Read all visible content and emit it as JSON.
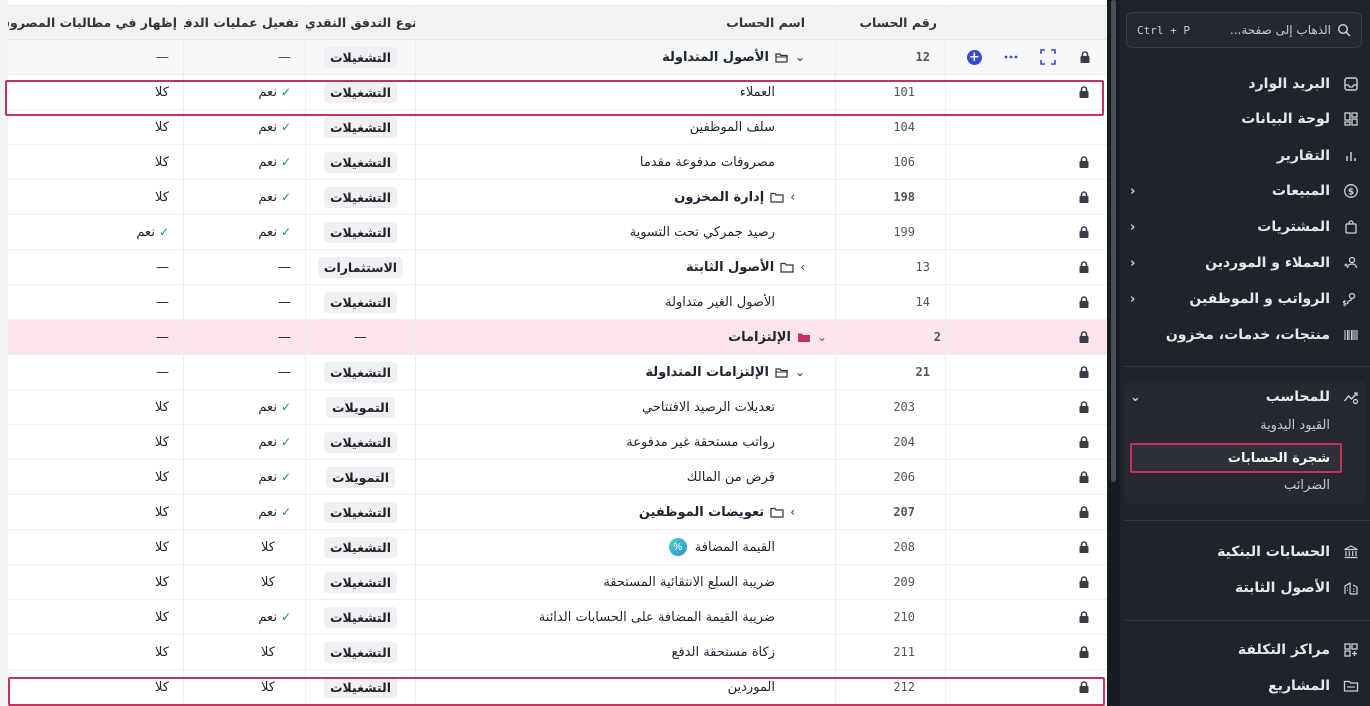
{
  "table": {
    "headers": {
      "num": "رقم الحساب",
      "name": "اسم الحساب",
      "flow": "نوع التدفق النقدي",
      "pay": "تفعيل عمليات الدفع",
      "exp": "إظهار في مطالبات المصروفات"
    },
    "rows": [
      {
        "num": "12",
        "name": "الأصول المتداولة",
        "flow": "التشغيلات",
        "pay": "—",
        "exp": "—"
      },
      {
        "num": "101",
        "name": "العملاء",
        "flow": "التشغيلات",
        "pay": "نعم",
        "exp": "كلا"
      },
      {
        "num": "104",
        "name": "سلف الموظفين",
        "flow": "التشغيلات",
        "pay": "نعم",
        "exp": "كلا"
      },
      {
        "num": "106",
        "name": "مصروفات مدفوعة مقدما",
        "flow": "التشغيلات",
        "pay": "نعم",
        "exp": "كلا"
      },
      {
        "num": "198",
        "name": "إدارة المخزون",
        "flow": "التشغيلات",
        "pay": "نعم",
        "exp": "كلا"
      },
      {
        "num": "199",
        "name": "رصيد جمركي تحت التسوية",
        "flow": "التشغيلات",
        "pay": "نعم",
        "exp": "نعم"
      },
      {
        "num": "13",
        "name": "الأصول الثابتة",
        "flow": "الاستثمارات",
        "pay": "—",
        "exp": "—"
      },
      {
        "num": "14",
        "name": "الأصول الغير متداولة",
        "flow": "التشغيلات",
        "pay": "—",
        "exp": "—"
      },
      {
        "num": "2",
        "name": "الإلتزامات",
        "flow": "—",
        "pay": "—",
        "exp": "—"
      },
      {
        "num": "21",
        "name": "الإلتزامات المتداولة",
        "flow": "التشغيلات",
        "pay": "—",
        "exp": "—"
      },
      {
        "num": "203",
        "name": "تعديلات الرصيد الافتتاحي",
        "flow": "التمويلات",
        "pay": "نعم",
        "exp": "كلا"
      },
      {
        "num": "204",
        "name": "رواتب مستحقة غير مدفوعة",
        "flow": "التشغيلات",
        "pay": "نعم",
        "exp": "كلا"
      },
      {
        "num": "206",
        "name": "قرض من المالك",
        "flow": "التمويلات",
        "pay": "نعم",
        "exp": "كلا"
      },
      {
        "num": "207",
        "name": "تعويضات الموظفين",
        "flow": "التشغيلات",
        "pay": "نعم",
        "exp": "كلا"
      },
      {
        "num": "208",
        "name": "القيمة المضافة",
        "flow": "التشغيلات",
        "pay": "كلا",
        "exp": "كلا"
      },
      {
        "num": "209",
        "name": "ضريبة السلع الانتقائية المستحقة",
        "flow": "التشغيلات",
        "pay": "كلا",
        "exp": "كلا"
      },
      {
        "num": "210",
        "name": "ضريبة القيمة المضافة على الحسابات الدائنة",
        "flow": "التشغيلات",
        "pay": "نعم",
        "exp": "كلا"
      },
      {
        "num": "211",
        "name": "زكاة مستحقة الدفع",
        "flow": "التشغيلات",
        "pay": "كلا",
        "exp": "كلا"
      },
      {
        "num": "212",
        "name": "الموردين",
        "flow": "التشغيلات",
        "pay": "كلا",
        "exp": "كلا"
      }
    ]
  },
  "sidebar": {
    "search": {
      "placeholder": "الذهاب إلى صفحة...",
      "shortcut": "Ctrl + P"
    },
    "items": {
      "inbox": "البريد الوارد",
      "dashboard": "لوحة البيانات",
      "reports": "التقارير",
      "sales": "المبيعات",
      "purchases": "المشتريات",
      "customers": "العملاء و الموردين",
      "payroll": "الرواتب و الموظفين",
      "products": "منتجات، خدمات، مخزون",
      "accountant": "للمحاسب",
      "manual_entries": "القيود اليدوية",
      "chart_of_accounts": "شجرة الحسابات",
      "taxes": "الضرائب",
      "bank_accounts": "الحسابات البنكية",
      "fixed_assets": "الأصول الثابتة",
      "cost_centers": "مراكز التكلفة",
      "projects": "المشاريع"
    }
  },
  "colors": {
    "highlight": "#c6305e",
    "accent": "#3b47d6",
    "check": "#1c9a4a",
    "sidebar_bg": "#21232b"
  }
}
